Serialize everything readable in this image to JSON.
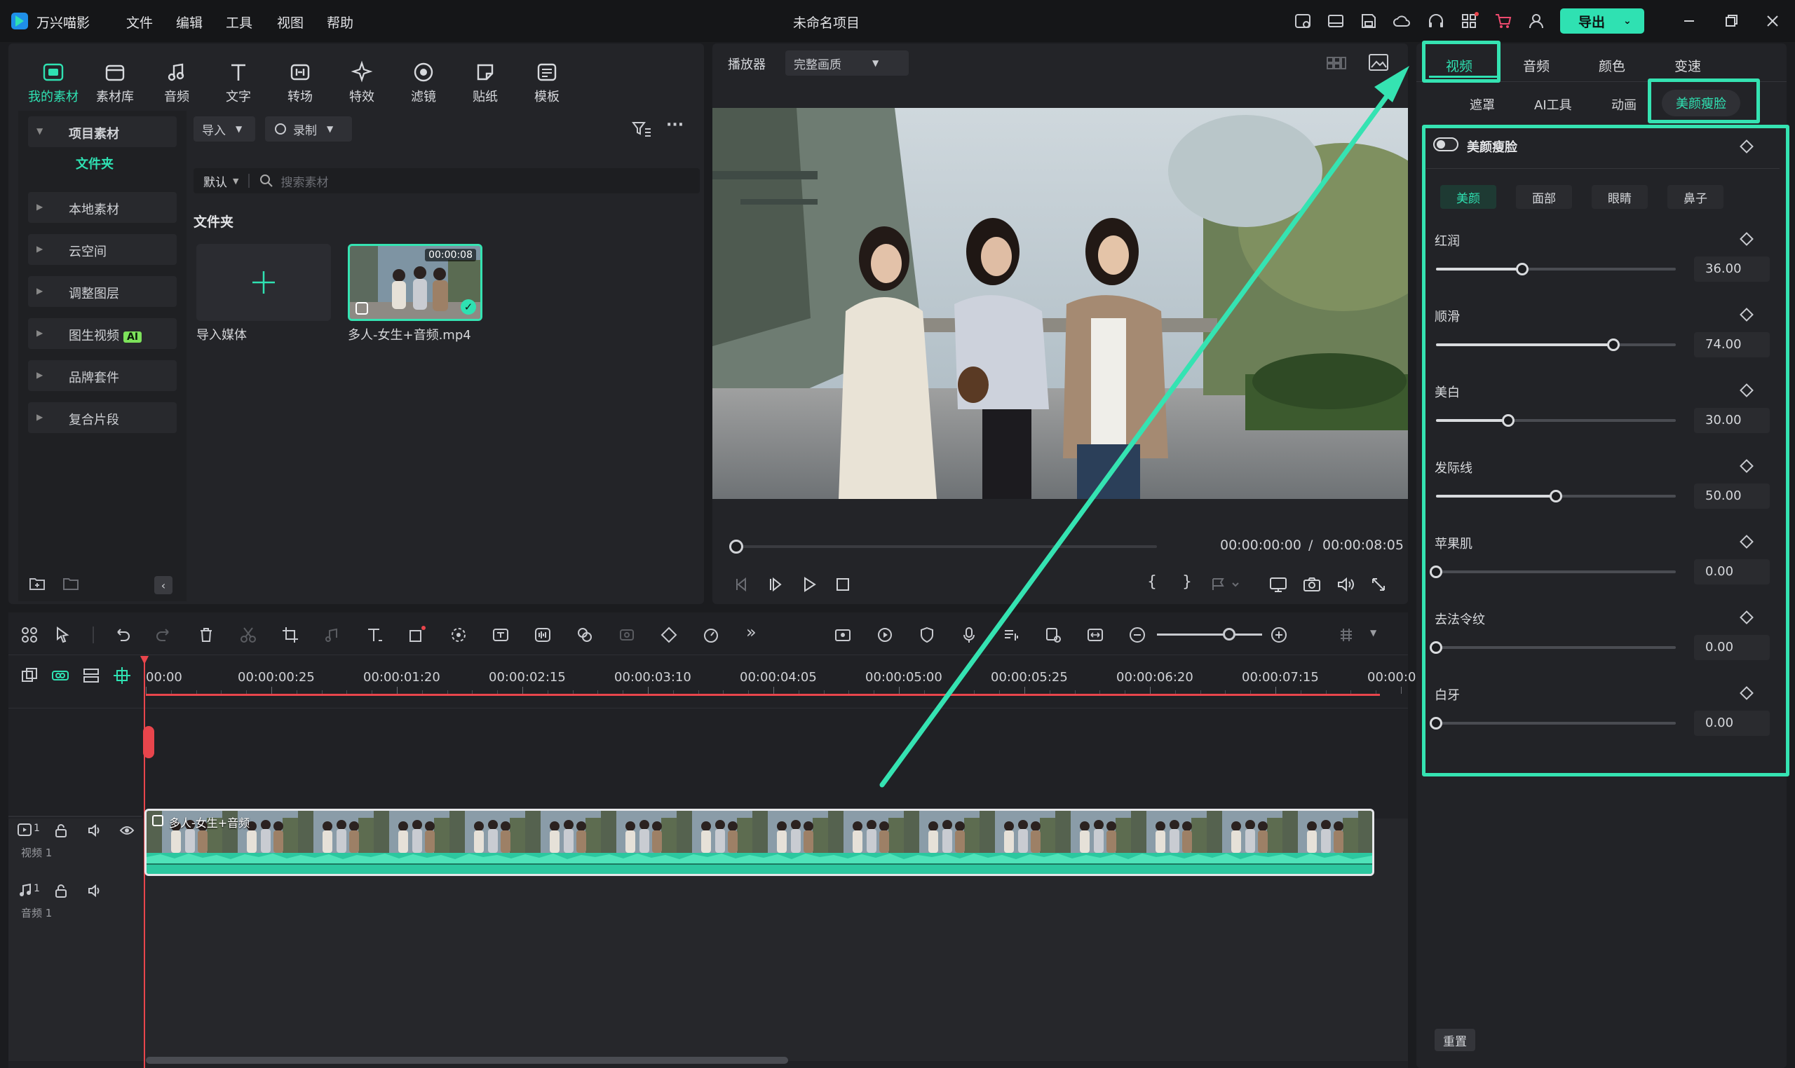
{
  "app": {
    "name": "万兴喵影",
    "project": "未命名项目",
    "export": "导出"
  },
  "menu": [
    "文件",
    "编辑",
    "工具",
    "视图",
    "帮助"
  ],
  "lib_tabs": [
    "我的素材",
    "素材库",
    "音频",
    "文字",
    "转场",
    "特效",
    "滤镜",
    "贴纸",
    "模板"
  ],
  "lib_side": {
    "items": [
      "项目素材",
      "文件夹",
      "本地素材",
      "云空间",
      "调整图层",
      "图生视频",
      "品牌套件",
      "复合片段"
    ],
    "ai_badge": "AI"
  },
  "lib_bar": {
    "import": "导入",
    "record": "录制",
    "sort": "默认",
    "search_placeholder": "搜索素材",
    "folder_title": "文件夹",
    "import_media": "导入媒体",
    "clip_name": "多人-女生+音频.mp4",
    "clip_duration": "00:00:08"
  },
  "viewer": {
    "player": "播放器",
    "quality": "完整画质",
    "current": "00:00:00:00",
    "sep": "/",
    "total": "00:00:08:05",
    "progress": 0
  },
  "inspector": {
    "tabs": [
      "视频",
      "音频",
      "颜色",
      "变速"
    ],
    "subtabs": [
      "遮罩",
      "AI工具",
      "动画",
      "美颜瘦脸"
    ],
    "section": "美颜瘦脸",
    "cats": [
      "美颜",
      "面部",
      "眼睛",
      "鼻子"
    ],
    "sliders": [
      {
        "label": "红润",
        "value": "36.00",
        "pct": 0.36
      },
      {
        "label": "顺滑",
        "value": "74.00",
        "pct": 0.74
      },
      {
        "label": "美白",
        "value": "30.00",
        "pct": 0.3
      },
      {
        "label": "发际线",
        "value": "50.00",
        "pct": 0.5
      },
      {
        "label": "苹果肌",
        "value": "0.00",
        "pct": 0
      },
      {
        "label": "去法令纹",
        "value": "0.00",
        "pct": 0
      },
      {
        "label": "白牙",
        "value": "0.00",
        "pct": 0
      }
    ],
    "reset": "重置"
  },
  "timeline": {
    "ticks": [
      "00:00",
      "00:00:00:25",
      "00:00:01:20",
      "00:00:02:15",
      "00:00:03:10",
      "00:00:04:05",
      "00:00:05:00",
      "00:00:05:25",
      "00:00:06:20",
      "00:00:07:15",
      "00:00:0"
    ],
    "video_track": "视频 1",
    "audio_track": "音频 1",
    "video_num": "1",
    "audio_num": "1",
    "clip_label": "多人-女生+音频"
  },
  "colors": {
    "accent": "#2fe1b2",
    "highlight": "#35e3b2",
    "playhead": "#e8454c"
  }
}
